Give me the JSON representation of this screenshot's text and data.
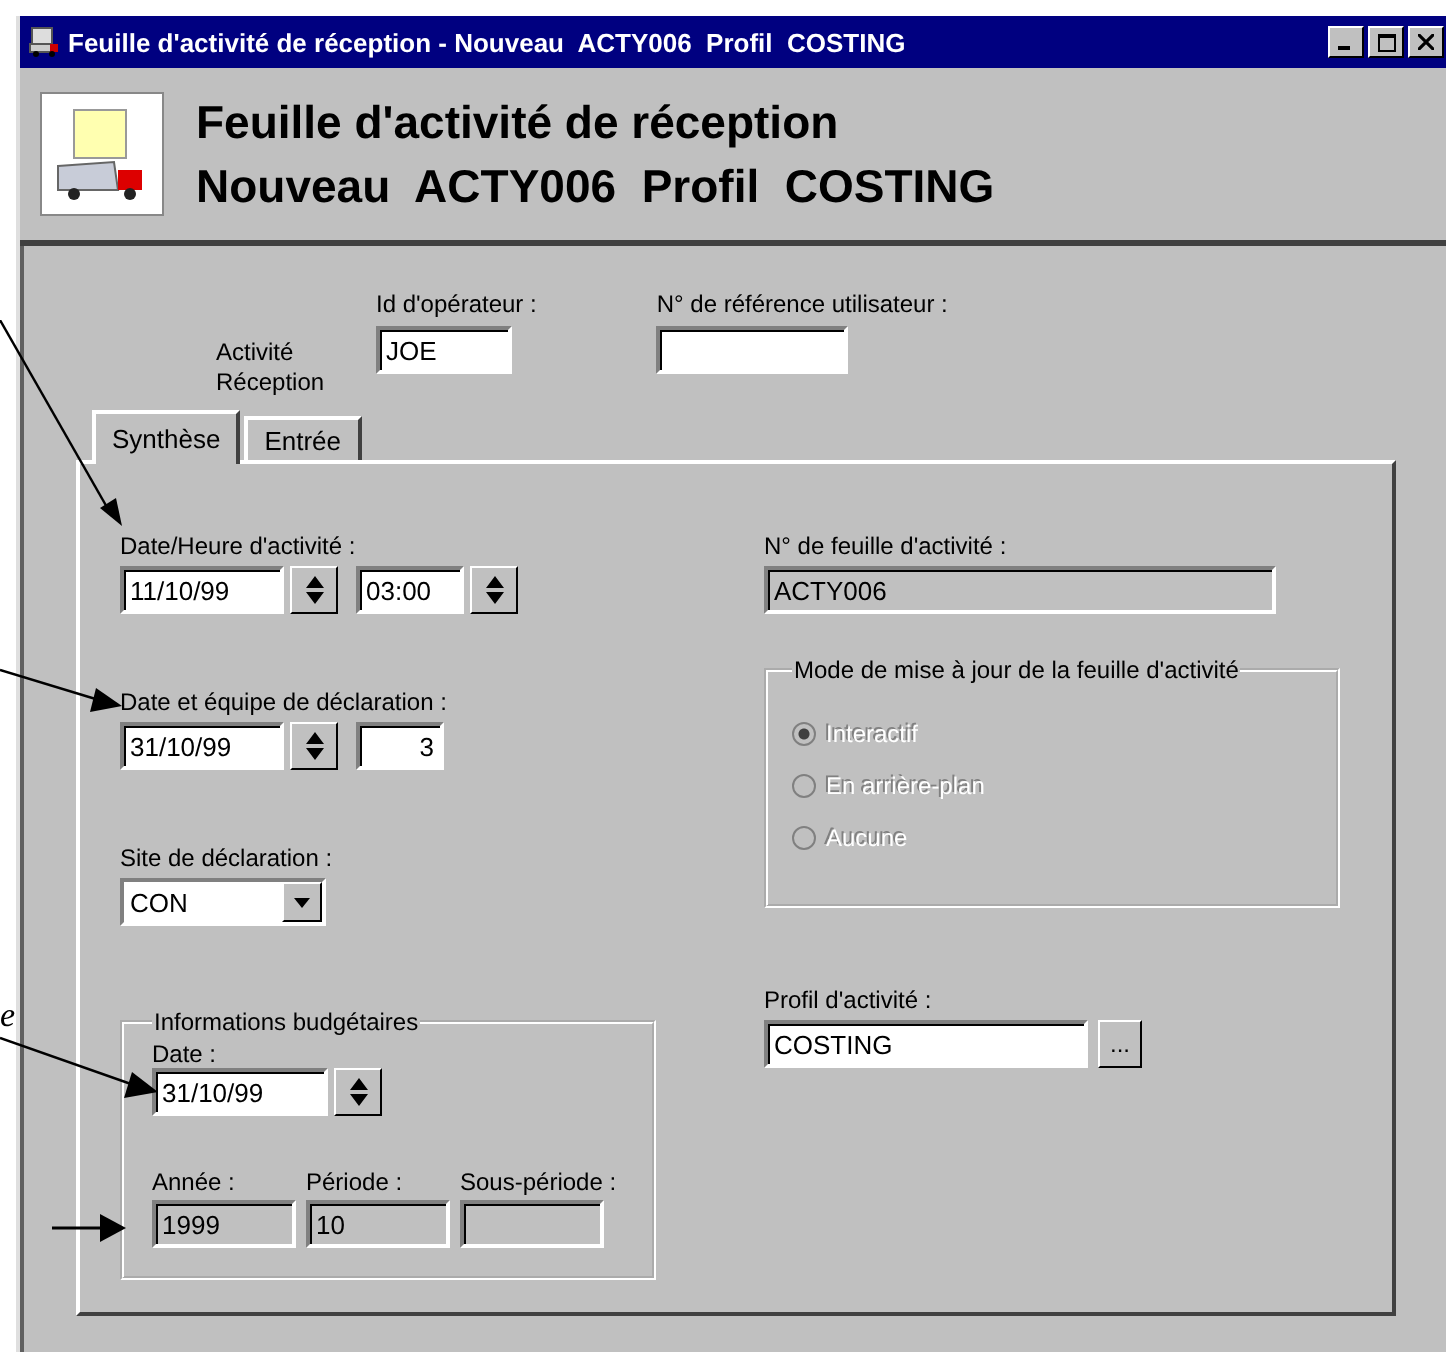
{
  "window": {
    "title": "Feuille d'activité de réception - Nouveau  ACTY006  Profil  COSTING"
  },
  "header": {
    "title": "Feuille d'activité de réception",
    "subtitle": "Nouveau  ACTY006  Profil  COSTING"
  },
  "activity_label": "Activité Réception",
  "operator": {
    "label": "Id d'opérateur :",
    "value": "JOE"
  },
  "user_reference": {
    "label": "N° de référence utilisateur :"
  },
  "tabs": [
    {
      "label": "Synthèse",
      "selected": true
    },
    {
      "label": "Entrée",
      "selected": false
    }
  ],
  "activity_datetime": {
    "label": "Date/Heure d'activité :",
    "date": "11/10/99",
    "time": "03:00"
  },
  "declaration": {
    "label": "Date et équipe de déclaration :",
    "date": "31/10/99",
    "shift": "3"
  },
  "site": {
    "label": "Site de déclaration :",
    "value": "CON"
  },
  "budget": {
    "title": "Informations budgétaires",
    "date_label": "Date :",
    "date": "31/10/99",
    "fields": [
      {
        "label": "Année :",
        "value": "1999",
        "disabled": true
      },
      {
        "label": "Période :",
        "value": "10",
        "disabled": true
      },
      {
        "label": "Sous-période :",
        "disabled": true
      }
    ]
  },
  "sheet_number": {
    "label": "N° de feuille d'activité :",
    "value": "ACTY006",
    "disabled": true
  },
  "update_mode": {
    "title": "Mode de mise à jour de la feuille d'activité",
    "disabled": true,
    "options": [
      {
        "label": "Interactif",
        "selected": true
      },
      {
        "label": "En arrière-plan",
        "selected": false
      },
      {
        "label": "Aucune",
        "selected": false
      }
    ]
  },
  "profile": {
    "label": "Profil d'activité :",
    "value": "COSTING",
    "button": "..."
  },
  "margin_note": "e"
}
